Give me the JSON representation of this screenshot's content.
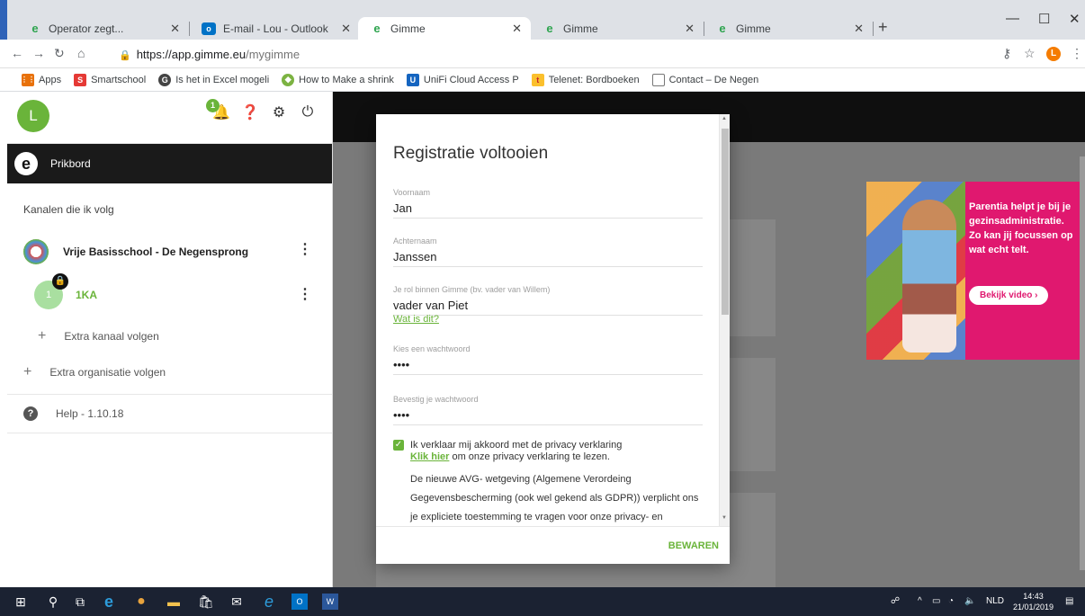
{
  "browser": {
    "tabs": [
      {
        "title": "Operator zegt...",
        "icon": "gimme-icon"
      },
      {
        "title": "E-mail - Lou - Outlook",
        "icon": "outlook-icon"
      },
      {
        "title": "Gimme",
        "icon": "gimme-icon",
        "active": true
      },
      {
        "title": "Gimme",
        "icon": "gimme-icon"
      },
      {
        "title": "Gimme",
        "icon": "gimme-icon"
      }
    ],
    "url_host": "https://app.gimme.eu",
    "url_path": "/mygimme",
    "profile_initial": "L",
    "bookmarks": [
      {
        "label": "Apps",
        "icon": "apps-grid-icon"
      },
      {
        "label": "Smartschool",
        "icon": "smartschool-icon"
      },
      {
        "label": "Is het in Excel mogeli",
        "icon": "g-icon"
      },
      {
        "label": "How to Make a shrink",
        "icon": "bookmark-icon"
      },
      {
        "label": "UniFi Cloud Access P",
        "icon": "unifi-icon"
      },
      {
        "label": "Telenet: Bordboeken",
        "icon": "telenet-icon"
      },
      {
        "label": "Contact – De Negen",
        "icon": "page-icon"
      }
    ]
  },
  "sidebar": {
    "user_initial": "L",
    "notification_count": "1",
    "prikbord_label": "Prikbord",
    "channels_heading": "Kanalen die ik volg",
    "organization": "Vrije Basisschool - De Negensprong",
    "subchannel": {
      "avatar": "1",
      "name": "1KA"
    },
    "add_channel": "Extra kanaal volgen",
    "add_organization": "Extra organisatie volgen",
    "help": "Help - 1.10.18"
  },
  "ad": {
    "text": "Parentia helpt je bij je gezinsadministratie. Zo kan jij focussen op wat echt telt.",
    "button": "Bekijk video ›"
  },
  "modal": {
    "title": "Registratie voltooien",
    "fields": {
      "first_name": {
        "label": "Voornaam",
        "value": "Jan"
      },
      "last_name": {
        "label": "Achternaam",
        "value": "Janssen"
      },
      "role": {
        "label": "Je rol binnen Gimme (bv. vader van Willem)",
        "value": "vader van Piet"
      },
      "password": {
        "label": "Kies een wachtwoord",
        "value": "••••"
      },
      "password_confirm": {
        "label": "Bevestig je wachtwoord",
        "value": "••••"
      }
    },
    "role_help_link": "Wat is dit?",
    "consent_text": "Ik verklaar mij akkoord met de privacy verklaring",
    "consent_link": "Klik hier",
    "consent_link_suffix": " om onze privacy verklaring te lezen.",
    "consent_paragraph": "De nieuwe AVG- wetgeving (Algemene Verordeing Gegevensbescherming (ook wel gekend als GDPR)) verplicht ons je expliciete toestemming te vragen voor onze privacy- en",
    "save_button": "BEWAREN"
  },
  "taskbar": {
    "language": "NLD",
    "time": "14:43",
    "date": "21/01/2019"
  }
}
